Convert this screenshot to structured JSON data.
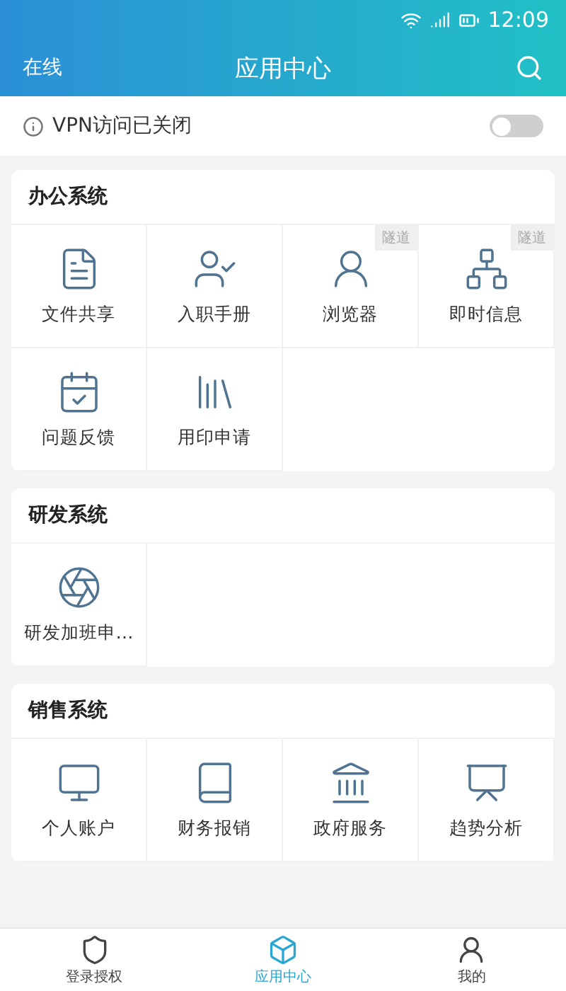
{
  "status_bar": {
    "time": "12:09"
  },
  "header": {
    "status": "在线",
    "title": "应用中心"
  },
  "vpn": {
    "label": "VPN访问已关闭",
    "on": false
  },
  "sections": [
    {
      "title": "办公系统",
      "apps": [
        {
          "label": "文件共享"
        },
        {
          "label": "入职手册"
        },
        {
          "label": "浏览器",
          "tag": "隧道"
        },
        {
          "label": "即时信息",
          "tag": "隧道"
        },
        {
          "label": "问题反馈"
        },
        {
          "label": "用印申请"
        }
      ]
    },
    {
      "title": "研发系统",
      "apps": [
        {
          "label": "研发加班申…"
        }
      ]
    },
    {
      "title": "销售系统",
      "apps": [
        {
          "label": "个人账户"
        },
        {
          "label": "财务报销"
        },
        {
          "label": "政府服务"
        },
        {
          "label": "趋势分析"
        }
      ]
    }
  ],
  "tab_bar": [
    {
      "label": "登录授权",
      "selected": false
    },
    {
      "label": "应用中心",
      "selected": true
    },
    {
      "label": "我的",
      "selected": false
    }
  ]
}
